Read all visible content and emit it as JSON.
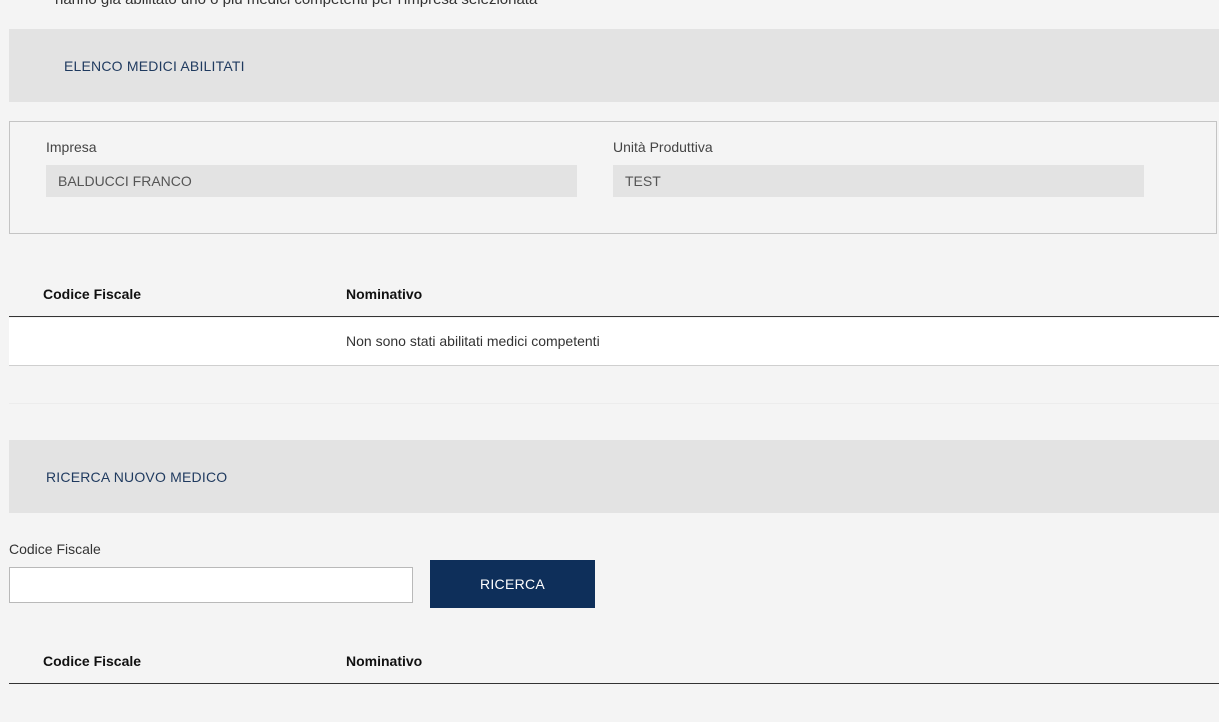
{
  "top_clipped_text": "hanno già abilitato uno o più medici competenti per l'impresa selezionata",
  "section_enabled": {
    "title": "ELENCO MEDICI ABILITATI"
  },
  "company": {
    "impresa_label": "Impresa",
    "impresa_value": "BALDUCCI FRANCO",
    "unit_label": "Unità Produttiva",
    "unit_value": "TEST"
  },
  "enabled_table": {
    "columns": [
      "Codice Fiscale",
      "Nominativo"
    ],
    "empty_message": "Non sono stati abilitati medici competenti"
  },
  "section_search": {
    "title": "RICERCA NUOVO MEDICO"
  },
  "search_form": {
    "codice_fiscale_label": "Codice Fiscale",
    "codice_fiscale_value": "",
    "button_label": "RICERCA"
  },
  "results_table": {
    "columns": [
      "Codice Fiscale",
      "Nominativo"
    ]
  },
  "colors": {
    "page_background": "#f4f4f4",
    "section_header_background": "#e3e3e3",
    "section_title": "#1f3a5f",
    "primary_button": "#0e2f5a"
  }
}
